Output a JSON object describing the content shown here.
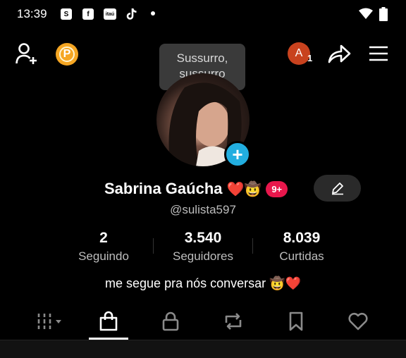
{
  "status_bar": {
    "time": "13:39",
    "notif_icons": [
      "shopee-icon",
      "facebook-icon",
      "itau-icon",
      "tiktok-icon"
    ],
    "itau_text": "itaú",
    "shopee_text": "S",
    "facebook_text": "f"
  },
  "header": {
    "coin_label": "P",
    "tooltip": "Sussurro, sussurro",
    "account_initial": "A",
    "account_count": "1"
  },
  "profile": {
    "name": "Sabrina Gaúcha",
    "emoji": "❤️🤠",
    "badge": "9+",
    "handle": "@sulista597",
    "bio": "me segue pra nós conversar 🤠❤️"
  },
  "stats": [
    {
      "value": "2",
      "label": "Seguindo"
    },
    {
      "value": "3.540",
      "label": "Seguidores"
    },
    {
      "value": "8.039",
      "label": "Curtidas"
    }
  ],
  "tabs": [
    "grid-icon",
    "shop-bag-icon",
    "lock-icon",
    "repost-icon",
    "bookmark-icon",
    "heart-icon"
  ],
  "colors": {
    "accent_blue": "#22aee0",
    "badge_red": "#e8174c",
    "coin": "#f5a623",
    "avatar_account": "#c8421e"
  }
}
